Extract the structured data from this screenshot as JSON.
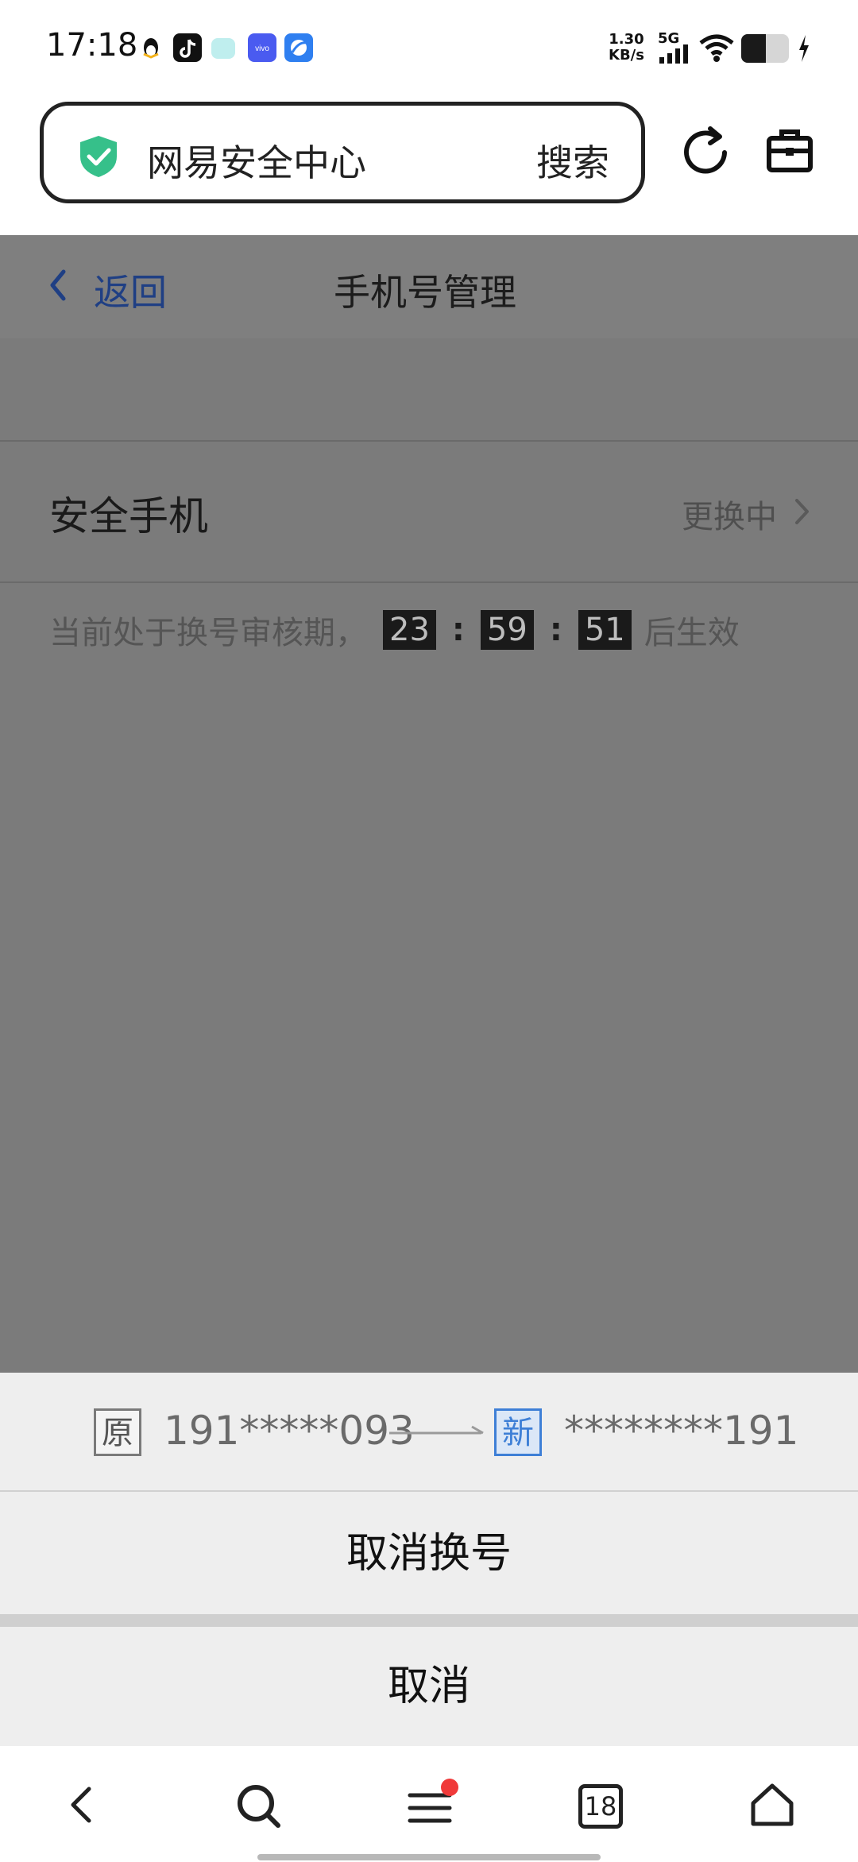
{
  "status_bar": {
    "time": "17:18",
    "net_speed_value": "1.30",
    "net_speed_unit": "KB/s",
    "network": "5G",
    "app_icons": [
      "qq-icon",
      "douyin-icon",
      "chat-icon",
      "vivo-icon",
      "browser-icon"
    ]
  },
  "browser": {
    "url_text": "网易安全中心",
    "search_label": "搜索",
    "tab_count": "18"
  },
  "page": {
    "back_label": "返回",
    "title": "手机号管理",
    "security_phone_label": "安全手机",
    "security_phone_status": "更换中",
    "notice_prefix": "当前处于换号审核期，",
    "countdown": {
      "hours": "23",
      "minutes": "59",
      "seconds": "51",
      "separator": ":"
    },
    "notice_suffix": "后生效"
  },
  "sheet": {
    "old_tag": "原",
    "old_number": "191*****093",
    "new_tag": "新",
    "new_number": "********191",
    "cancel_change_label": "取消换号",
    "cancel_label": "取消"
  },
  "colors": {
    "overlay_gray": "#7b7b7b",
    "link_blue": "#1f3f84",
    "shield_green": "#36c08a",
    "new_tag_blue": "#3e7fd6",
    "notification_dot": "#f03a3a"
  }
}
